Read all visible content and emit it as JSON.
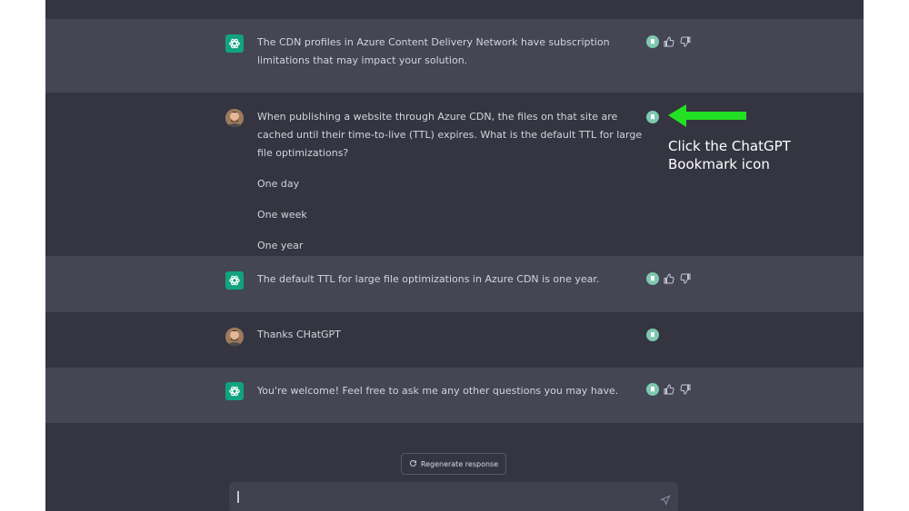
{
  "messages": [
    {
      "role": "assistant",
      "paragraphs": [
        "The CDN profiles in Azure Content Delivery Network have subscription limitations that may impact your solution."
      ]
    },
    {
      "role": "user",
      "paragraphs": [
        "When publishing a website through Azure CDN, the files on that site are cached until their time-to-live (TTL) expires. What is the default TTL for large file optimizations?",
        "One day",
        "One week",
        "One year"
      ]
    },
    {
      "role": "assistant",
      "paragraphs": [
        "The default TTL for large file optimizations in Azure CDN is one year."
      ]
    },
    {
      "role": "user",
      "paragraphs": [
        "Thanks CHatGPT"
      ]
    },
    {
      "role": "assistant",
      "paragraphs": [
        "You're welcome! Feel free to ask me any other questions you may have."
      ]
    }
  ],
  "regenerate_label": "Regenerate response",
  "annotation": {
    "line1": "Click the ChatGPT",
    "line2": "Bookmark icon",
    "arrow_color": "#22e022"
  },
  "colors": {
    "background": "#343541",
    "assistant_row": "#444654",
    "gpt_avatar": "#10a37f",
    "bookmark_icon": "#7ec8b0"
  },
  "icons": {
    "gpt_avatar": "openai-logo-icon",
    "user_avatar": "user-photo",
    "bookmark": "bookmark-icon",
    "like": "thumbs-up-icon",
    "dislike": "thumbs-down-icon",
    "regenerate": "refresh-icon",
    "send": "send-icon"
  }
}
